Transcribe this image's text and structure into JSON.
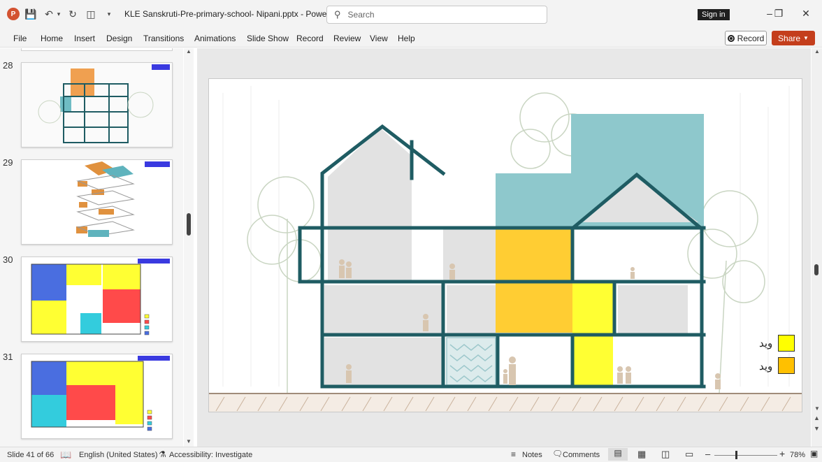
{
  "titlebar": {
    "app_logo": "P",
    "doc_title": "KLE Sanskruti-Pre-primary-school- Nipani.pptx  -  PowerP...",
    "search_placeholder": "Search",
    "signin_label": "Sign in"
  },
  "menu": [
    "File",
    "Home",
    "Insert",
    "Design",
    "Transitions",
    "Animations",
    "Slide Show",
    "Record",
    "Review",
    "View",
    "Help"
  ],
  "ribbon_right": {
    "record_label": "Record",
    "share_label": "Share"
  },
  "thumbnails": [
    {
      "number": "28"
    },
    {
      "number": "29"
    },
    {
      "number": "30"
    },
    {
      "number": "31"
    }
  ],
  "slide": {
    "legend": [
      {
        "label": "وید",
        "color": "#ffff00"
      },
      {
        "label": "وید",
        "color": "#ffc000"
      }
    ]
  },
  "colors": {
    "wall": "#1f5c63",
    "teal_block": "#8ec8cc",
    "void_yellow": "#ffff00",
    "void_orange": "#ffc000",
    "accent": "#c43e1c"
  },
  "status": {
    "slide_info": "Slide 41 of 66",
    "language": "English (United States)",
    "accessibility": "Accessibility: Investigate",
    "notes_label": "Notes",
    "comments_label": "Comments",
    "zoom": "78%"
  }
}
